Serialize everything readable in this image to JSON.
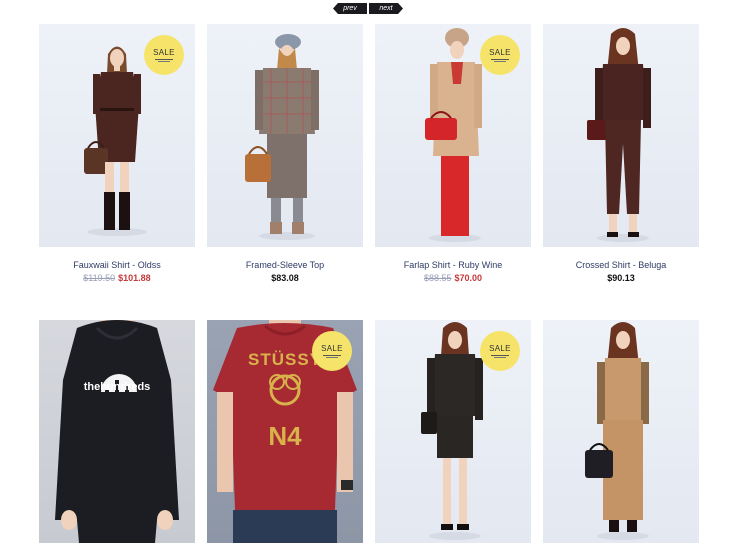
{
  "pager": {
    "prev": "prev",
    "next": "next"
  },
  "sale_label": "SALE",
  "products": [
    {
      "title": "Fauxwaii Shirt - Oldss",
      "old_price": "$119.50",
      "price": "$101.88",
      "sale": true
    },
    {
      "title": "Framed-Sleeve Top",
      "price": "$83.08",
      "sale": false
    },
    {
      "title": "Farlap Shirt - Ruby Wine",
      "old_price": "$88.55",
      "price": "$70.00",
      "sale": true
    },
    {
      "title": "Crossed Shirt - Beluga",
      "price": "$90.13",
      "sale": false
    },
    {
      "brand_text": "thehundreds",
      "sale": false
    },
    {
      "brand_text": "STÜSSY",
      "sale": true
    },
    {
      "sale": true
    },
    {
      "sale": false
    }
  ]
}
